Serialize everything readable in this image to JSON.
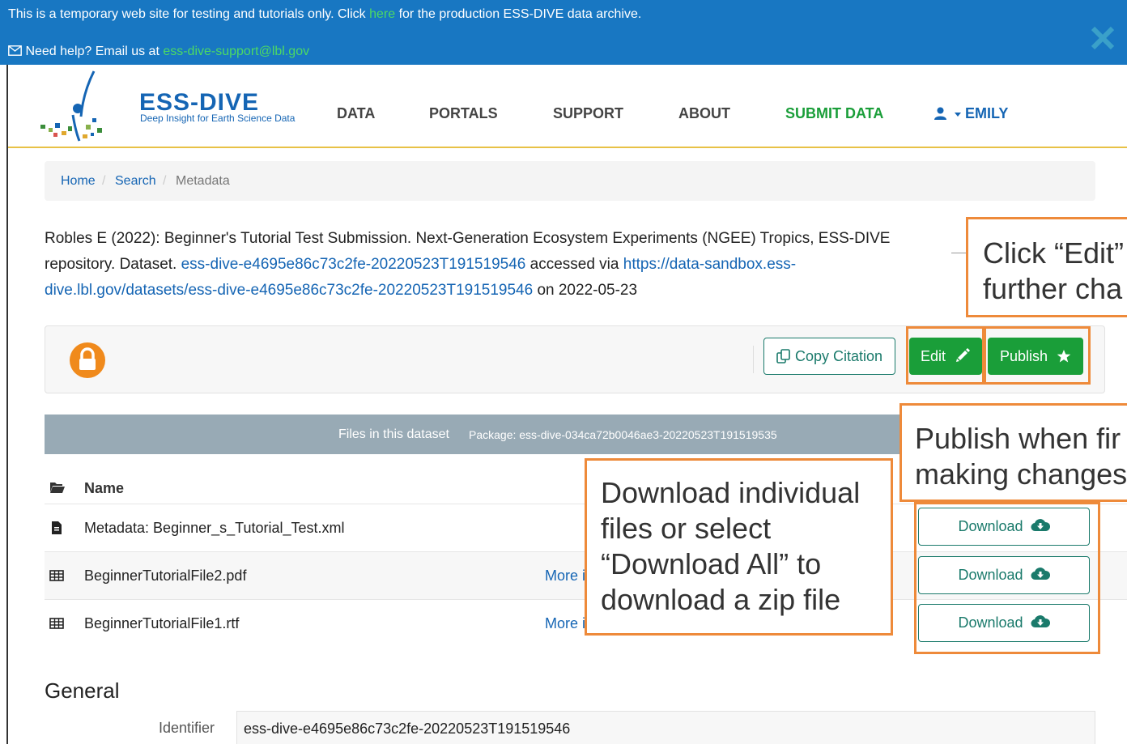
{
  "banner": {
    "line1_before": "This is a temporary web site for testing and tutorials only. Click ",
    "line1_link": "here",
    "line1_after": " for the production ESS-DIVE data archive.",
    "line2_before": "Need help? Email us at ",
    "line2_email": "ess-dive-support@lbl.gov",
    "mail_icon": "envelope-icon",
    "close_icon": "close-icon"
  },
  "header": {
    "logo_title": "ESS-DIVE",
    "logo_subtitle": "Deep Insight for Earth Science Data",
    "nav": {
      "data": "DATA",
      "portals": "PORTALS",
      "support": "SUPPORT",
      "about": "ABOUT",
      "submit": "SUBMIT DATA",
      "user": "EMILY"
    },
    "user_icon": "user-icon"
  },
  "breadcrumb": {
    "home": "Home",
    "search": "Search",
    "current": "Metadata",
    "sep": "/"
  },
  "citation": {
    "text1": "Robles E (2022): Beginner's Tutorial Test Submission. Next-Generation Ecosystem Experiments (NGEE) Tropics, ESS-DIVE repository. Dataset. ",
    "doi": "ess-dive-e4695e86c73c2fe-20220523T191519546",
    "text2": " accessed via ",
    "url": "https://data-sandbox.ess-dive.lbl.gov/datasets/ess-dive-e4695e86c73c2fe-20220523T191519546",
    "text3": " on 2022-05-23"
  },
  "toolbar": {
    "copy": "Copy Citation",
    "edit": "Edit",
    "publish": "Publish",
    "lock_icon": "lock-icon",
    "copy_icon": "copy-icon",
    "pencil_icon": "pencil-icon",
    "star_icon": "star-icon"
  },
  "files": {
    "title": "Files in this dataset",
    "package": "Package: ess-dive-034ca72b0046ae3-20220523T191519535",
    "name_header": "Name",
    "rows": [
      {
        "name": "Metadata: Beginner_s_Tutorial_Test.xml",
        "more": "",
        "download": "Download",
        "icon": "file-icon"
      },
      {
        "name": "BeginnerTutorialFile2.pdf",
        "more": "More i",
        "download": "Download",
        "icon": "table-icon"
      },
      {
        "name": "BeginnerTutorialFile1.rtf",
        "more": "More i",
        "download": "Download",
        "icon": "table-icon"
      }
    ]
  },
  "general": {
    "title": "General",
    "identifier_label": "Identifier",
    "identifier_value": "ess-dive-e4695e86c73c2fe-20220523T191519546"
  },
  "callouts": {
    "edit": "Click “Edit”\nfurther cha",
    "publish": "Publish when fir\nmaking changes",
    "download": "Download individual\nfiles or select\n“Download All” to\ndownload a zip file"
  },
  "colors": {
    "banner": "#1877c2",
    "accent_green": "#1a9e39",
    "link_blue": "#1565b4",
    "callout_orange": "#ee8a3a",
    "lock_orange": "#f08a1c"
  }
}
